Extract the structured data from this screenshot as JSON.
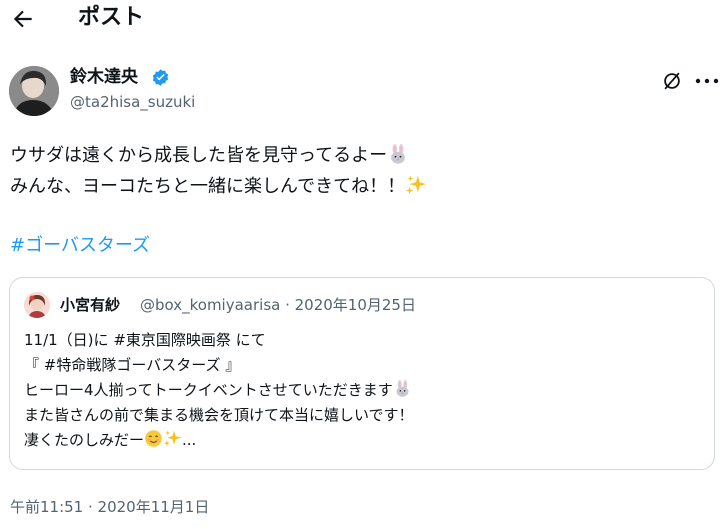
{
  "header": {
    "title": "ポスト",
    "back_icon": "arrow-left-icon"
  },
  "author": {
    "name": "鈴木達央",
    "handle": "@ta2hisa_suzuki",
    "verified_color": "#1d9bf0",
    "verified_icon": "verified-badge-icon"
  },
  "tweet": {
    "line1": "ウサダは遠くから成長した皆を見守ってるよー",
    "line2": "みんな、ヨーコたちと一緒に楽しんできてね！！",
    "hashtag": "#ゴーバスターズ",
    "timestamp": "午前11:51 · 2020年11月1日"
  },
  "quote": {
    "name": "小宮有紗",
    "meta": "@box_komiyaarisa · 2020年10月25日",
    "l1_prefix": "11/1（日)に ",
    "l1_tag": "#東京国際映画祭",
    "l1_suffix": " にて",
    "l2_prefix": "『 ",
    "l2_tag": "#特命戦隊ゴーバスターズ",
    "l2_suffix": " 』",
    "line3": "ヒーロー4人揃ってトークイベントさせていただきます",
    "line4": "また皆さんの前で集まる機会を頂けて本当に嬉しいです！",
    "line5": "凄くたのしみだー",
    "ellipsis": "..."
  },
  "icons": {
    "grok": "grok-icon",
    "more": "more-icon",
    "rabbit": "rabbit-emoji-icon",
    "sparkles": "sparkles-emoji-icon",
    "smile": "smiling-face-emoji-icon"
  },
  "colors": {
    "link": "#1d9bf0",
    "muted": "#536471",
    "border": "#cfd9de"
  }
}
